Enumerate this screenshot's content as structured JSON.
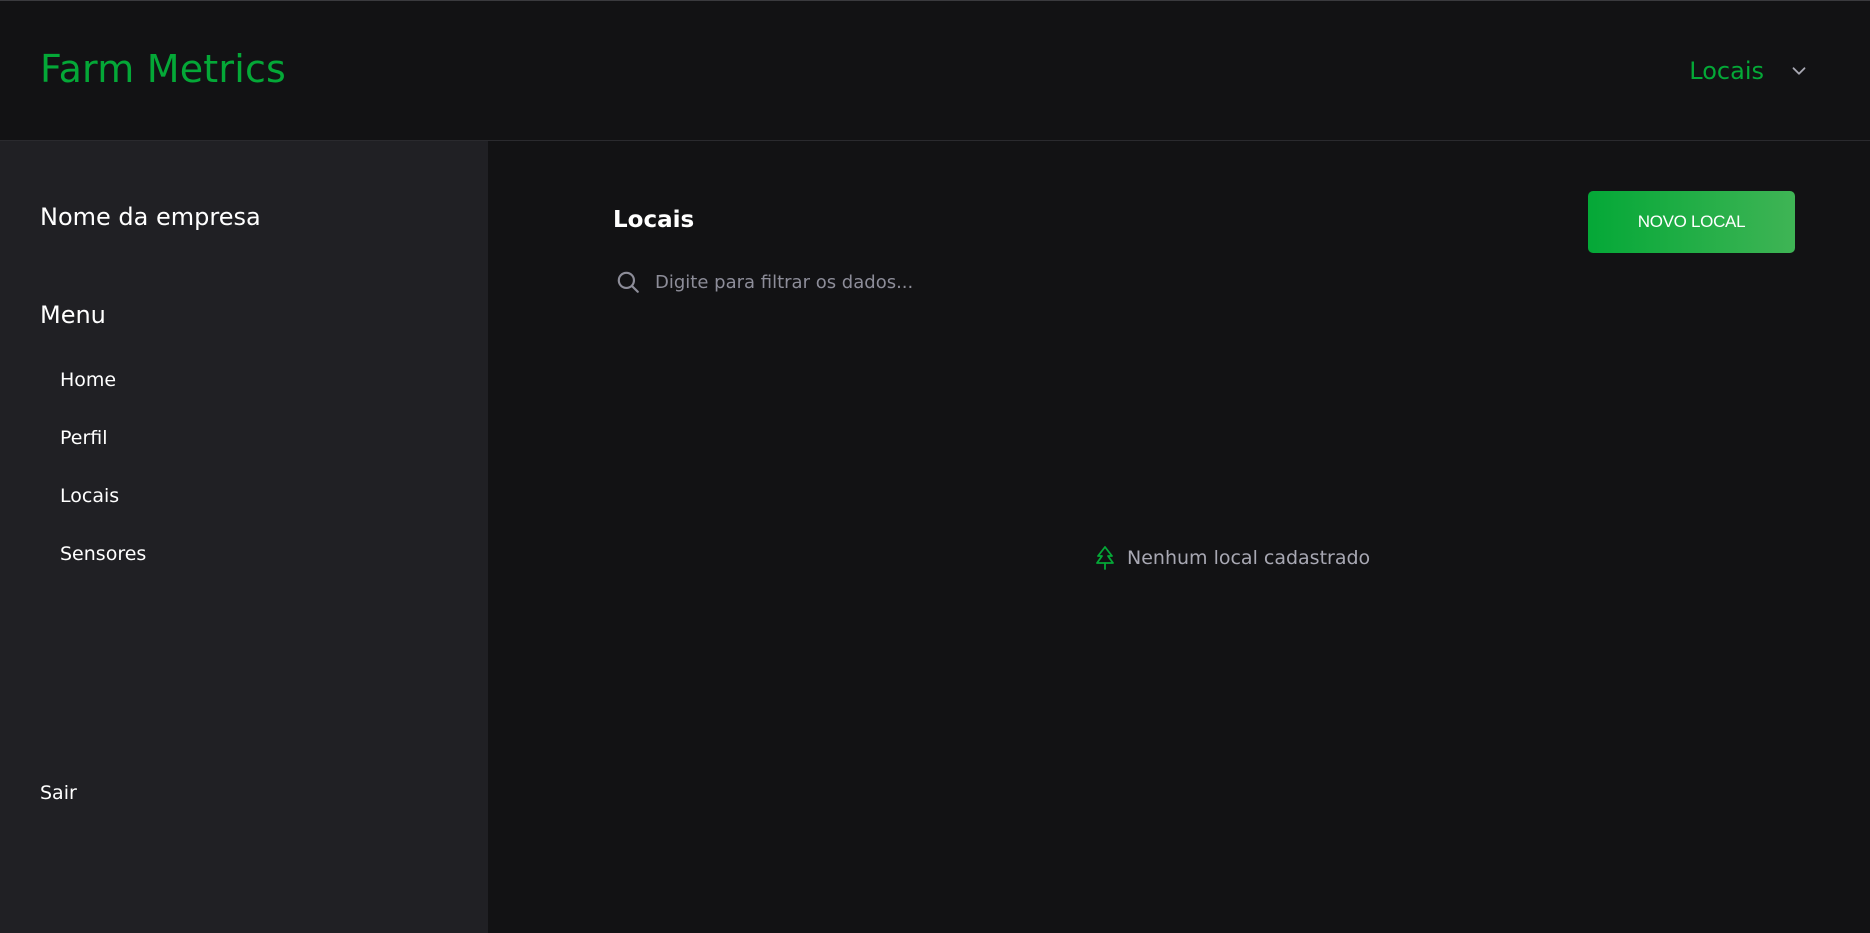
{
  "header": {
    "brand": "Farm Metrics",
    "user_menu_label": "Locais",
    "chevron_icon": "chevron-down-icon",
    "accent_color": "#04a837"
  },
  "sidebar": {
    "company_name": "Nome da empresa",
    "menu_title": "Menu",
    "items": [
      {
        "label": "Home"
      },
      {
        "label": "Perfil"
      },
      {
        "label": "Locais"
      },
      {
        "label": "Sensores"
      }
    ],
    "logout_label": "Sair"
  },
  "main": {
    "title": "Locais",
    "new_button_label": "NOVO LOCAL",
    "search": {
      "placeholder": "Digite para filtrar os dados...",
      "value": "",
      "icon": "search-icon"
    },
    "empty_state": {
      "icon": "tree-icon",
      "text": "Nenhum local cadastrado"
    }
  }
}
